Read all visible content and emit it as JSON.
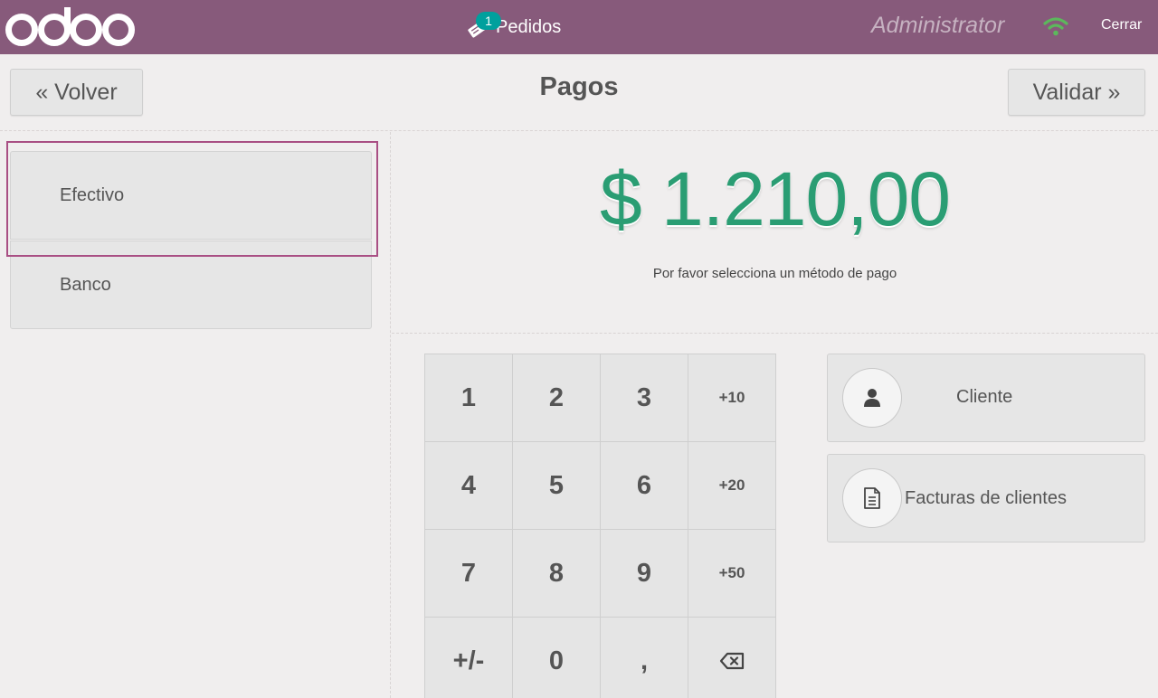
{
  "topbar": {
    "logo_text": "odoo",
    "orders_badge": "1",
    "orders_label": "Pedidos",
    "user": "Administrator",
    "close_label": "Cerrar",
    "colors": {
      "bar": "#875a7b",
      "badge": "#00a09d",
      "wifi": "#5cb85c"
    }
  },
  "header": {
    "back_label": "« Volver",
    "title": "Pagos",
    "validate_label": "Validar »"
  },
  "payment_methods": [
    {
      "label": "Efectivo",
      "selected": true
    },
    {
      "label": "Banco",
      "selected": false
    }
  ],
  "summary": {
    "amount": "$ 1.210,00",
    "prompt": "Por favor selecciona un método de pago",
    "amount_color": "#2a9d73"
  },
  "numpad": {
    "keys": [
      "1",
      "2",
      "3",
      "+10",
      "4",
      "5",
      "6",
      "+20",
      "7",
      "8",
      "9",
      "+50",
      "+/-",
      "0",
      ",",
      "backspace"
    ]
  },
  "actions": {
    "customer_label": "Cliente",
    "customer_icon": "user-icon",
    "invoices_label": "Facturas de clientes",
    "invoices_icon": "document-icon"
  }
}
